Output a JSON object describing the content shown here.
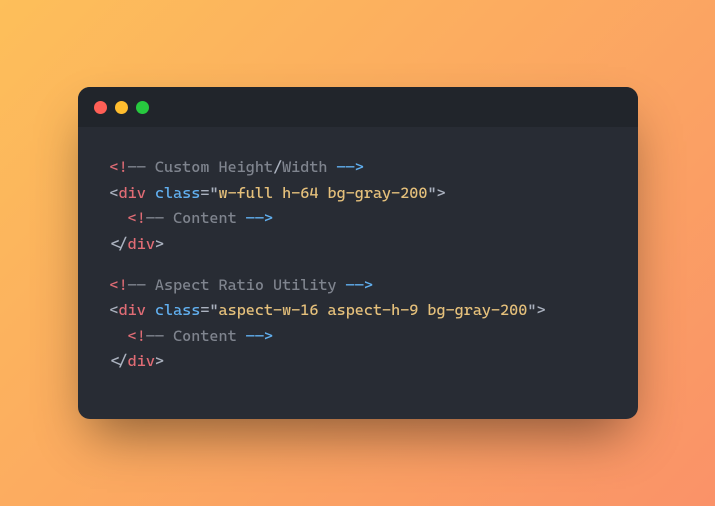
{
  "line1": {
    "open": "<!",
    "dash": "——",
    "text": " Custom Height",
    "slash": "/",
    "text2": "Width ",
    "close": "——>"
  },
  "line2": {
    "lt": "<",
    "tag": "div",
    "sp": " ",
    "attr": "class",
    "eq": "=",
    "q1": "\"",
    "val": "w-full h-64 bg-gray-200",
    "q2": "\"",
    "gt": ">"
  },
  "line3": {
    "indent": "  ",
    "open": "<!",
    "dash": "——",
    "text": " Content ",
    "close": "——>"
  },
  "line4": {
    "lt": "</",
    "tag": "div",
    "gt": ">"
  },
  "line6": {
    "open": "<!",
    "dash": "——",
    "text": " Aspect Ratio Utility ",
    "close": "——>"
  },
  "line7": {
    "lt": "<",
    "tag": "div",
    "sp": " ",
    "attr": "class",
    "eq": "=",
    "q1": "\"",
    "val": "aspect-w-16 aspect-h-9 bg-gray-200",
    "q2": "\"",
    "gt": ">"
  },
  "line8": {
    "indent": "  ",
    "open": "<!",
    "dash": "——",
    "text": " Content ",
    "close": "——>"
  },
  "line9": {
    "lt": "</",
    "tag": "div",
    "gt": ">"
  }
}
